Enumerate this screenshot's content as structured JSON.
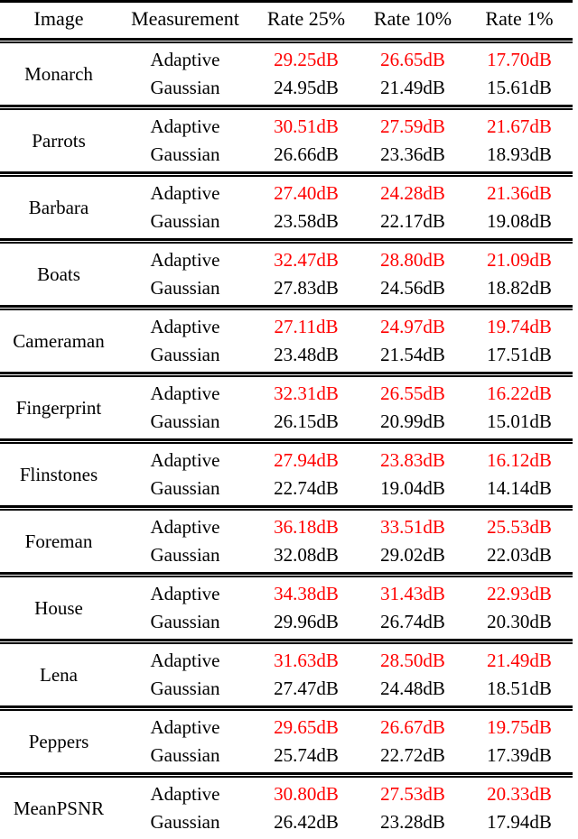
{
  "table": {
    "columns": [
      "Image",
      "Measurement",
      "Rate 25%",
      "Rate 10%",
      "Rate 1%"
    ],
    "measurement_labels": {
      "adaptive": "Adaptive",
      "gaussian": "Gaussian"
    },
    "accent_color": "#FF0000",
    "text_color": "#000000",
    "rows": [
      {
        "image": "Monarch",
        "adaptive": [
          "29.25dB",
          "26.65dB",
          "17.70dB"
        ],
        "gaussian": [
          "24.95dB",
          "21.49dB",
          "15.61dB"
        ]
      },
      {
        "image": "Parrots",
        "adaptive": [
          "30.51dB",
          "27.59dB",
          "21.67dB"
        ],
        "gaussian": [
          "26.66dB",
          "23.36dB",
          "18.93dB"
        ]
      },
      {
        "image": "Barbara",
        "adaptive": [
          "27.40dB",
          "24.28dB",
          "21.36dB"
        ],
        "gaussian": [
          "23.58dB",
          "22.17dB",
          "19.08dB"
        ]
      },
      {
        "image": "Boats",
        "adaptive": [
          "32.47dB",
          "28.80dB",
          "21.09dB"
        ],
        "gaussian": [
          "27.83dB",
          "24.56dB",
          "18.82dB"
        ]
      },
      {
        "image": "Cameraman",
        "adaptive": [
          "27.11dB",
          "24.97dB",
          "19.74dB"
        ],
        "gaussian": [
          "23.48dB",
          "21.54dB",
          "17.51dB"
        ]
      },
      {
        "image": "Fingerprint",
        "adaptive": [
          "32.31dB",
          "26.55dB",
          "16.22dB"
        ],
        "gaussian": [
          "26.15dB",
          "20.99dB",
          "15.01dB"
        ]
      },
      {
        "image": "Flinstones",
        "adaptive": [
          "27.94dB",
          "23.83dB",
          "16.12dB"
        ],
        "gaussian": [
          "22.74dB",
          "19.04dB",
          "14.14dB"
        ]
      },
      {
        "image": "Foreman",
        "adaptive": [
          "36.18dB",
          "33.51dB",
          "25.53dB"
        ],
        "gaussian": [
          "32.08dB",
          "29.02dB",
          "22.03dB"
        ]
      },
      {
        "image": "House",
        "adaptive": [
          "34.38dB",
          "31.43dB",
          "22.93dB"
        ],
        "gaussian": [
          "29.96dB",
          "26.74dB",
          "20.30dB"
        ]
      },
      {
        "image": "Lena",
        "adaptive": [
          "31.63dB",
          "28.50dB",
          "21.49dB"
        ],
        "gaussian": [
          "27.47dB",
          "24.48dB",
          "18.51dB"
        ]
      },
      {
        "image": "Peppers",
        "adaptive": [
          "29.65dB",
          "26.67dB",
          "19.75dB"
        ],
        "gaussian": [
          "25.74dB",
          "22.72dB",
          "17.39dB"
        ]
      },
      {
        "image": "MeanPSNR",
        "adaptive": [
          "30.80dB",
          "27.53dB",
          "20.33dB"
        ],
        "gaussian": [
          "26.42dB",
          "23.28dB",
          "17.94dB"
        ]
      }
    ]
  }
}
